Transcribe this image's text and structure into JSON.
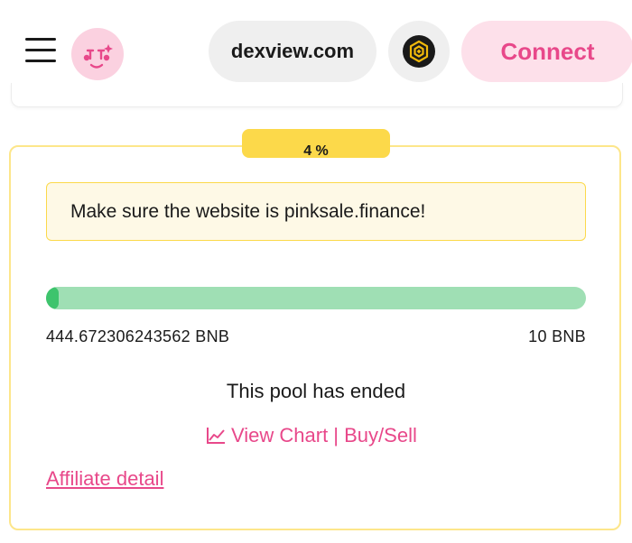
{
  "header": {
    "site_label": "dexview.com",
    "connect_label": "Connect",
    "chain_icon": "bnb-chain-icon",
    "menu_icon": "hamburger-menu-icon",
    "logo_icon": "pinksale-logo-icon"
  },
  "card": {
    "percent": "4 %",
    "notice": "Make sure the website is pinksale.finance!",
    "progress_fraction": 0.04,
    "raised": "444.672306243562 BNB",
    "cap": "10 BNB",
    "status": "This pool has ended",
    "chart_link": "View Chart | Buy/Sell",
    "chart_icon": "line-chart-icon",
    "affiliate": "Affiliate detail"
  },
  "colors": {
    "accent_pink": "#e8488a",
    "badge_yellow": "#fcd94a",
    "progress_track": "#9fdfb4",
    "progress_fill": "#3ec46d",
    "bnb_yellow": "#f0b90b"
  }
}
